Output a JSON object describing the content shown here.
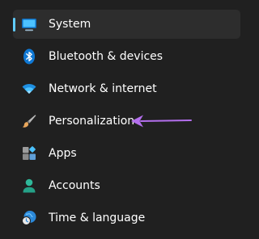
{
  "nav": {
    "items": [
      {
        "label": "System",
        "icon": "system-monitor-icon",
        "selected": true
      },
      {
        "label": "Bluetooth & devices",
        "icon": "bluetooth-icon"
      },
      {
        "label": "Network & internet",
        "icon": "wifi-icon"
      },
      {
        "label": "Personalization",
        "icon": "paintbrush-icon"
      },
      {
        "label": "Apps",
        "icon": "apps-icon"
      },
      {
        "label": "Accounts",
        "icon": "account-icon"
      },
      {
        "label": "Time & language",
        "icon": "globe-clock-icon"
      }
    ]
  },
  "annotation": {
    "icon": "arrow-left-icon",
    "color": "#b46fee"
  },
  "colors": {
    "background": "#202020",
    "selected_bg": "#2d2d2d",
    "accent": "#60cdff"
  }
}
